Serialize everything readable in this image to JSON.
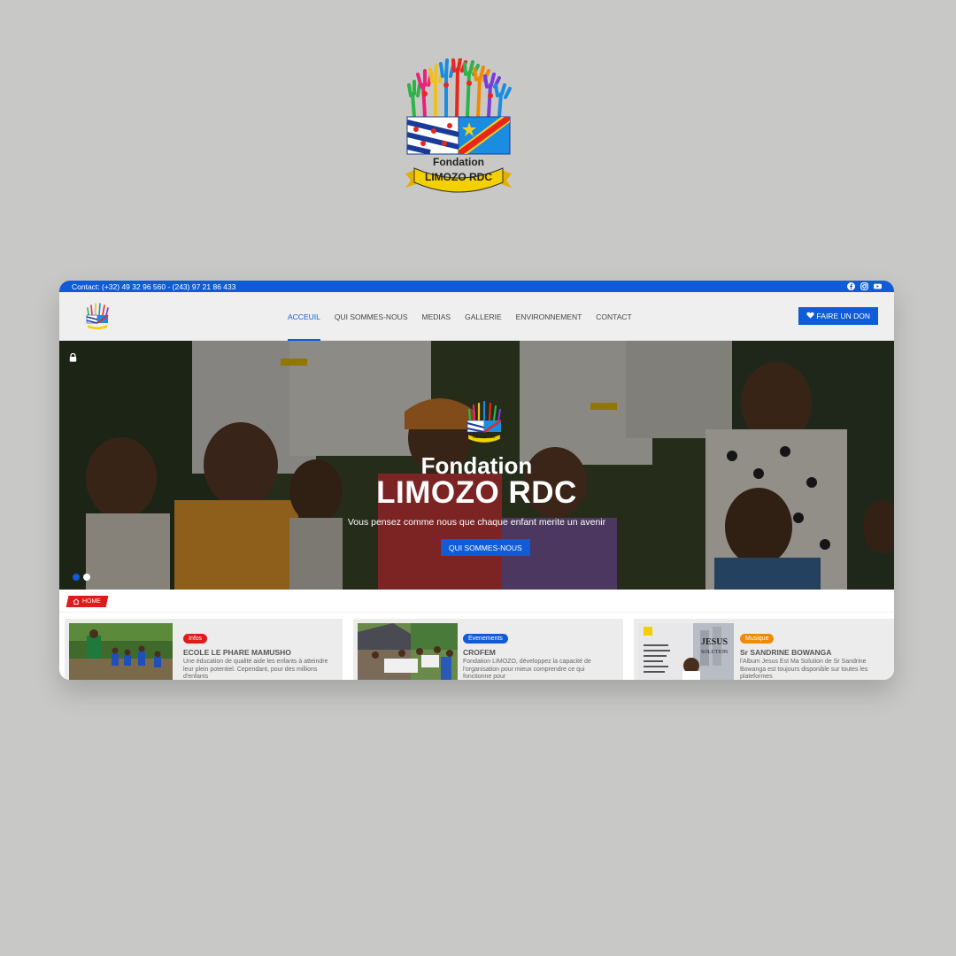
{
  "topbar": {
    "contact": "Contact: (+32) 49 32 96 560 - (243) 97 21 86 433",
    "socials": [
      "facebook-icon",
      "instagram-icon",
      "youtube-icon"
    ]
  },
  "brand": {
    "logo_line1": "Fondation",
    "logo_line2": "LIMOZO RDC",
    "logo_small": "LIMOZO RDC"
  },
  "nav": {
    "items": [
      {
        "label": "ACCEUIL",
        "active": true
      },
      {
        "label": "QUI SOMMES-NOUS",
        "active": false
      },
      {
        "label": "MEDIAS",
        "active": false
      },
      {
        "label": "GALLERIE",
        "active": false
      },
      {
        "label": "ENVIRONNEMENT",
        "active": false
      },
      {
        "label": "CONTACT",
        "active": false
      }
    ],
    "donate_label": "FAIRE UN DON"
  },
  "hero": {
    "title_line1": "Fondation",
    "title_line2": "LIMOZO RDC",
    "subtitle": "Vous pensez comme nous que chaque enfant merite un avenir",
    "button": "QUI SOMMES-NOUS",
    "slides": 2,
    "active_slide": 1
  },
  "breadcrumb": {
    "home": "HOME"
  },
  "cards": [
    {
      "tag": "Infos",
      "tag_color": "#e01a1a",
      "title": "ECOLE LE PHARE MAMUSHO",
      "text": "Une éducation de qualité aide les enfants à atteindre leur plein potentiel. Cependant, pour des millions d'enfants"
    },
    {
      "tag": "Evenements",
      "tag_color": "#0f5bd8",
      "title": "CROFEM",
      "text": "Fondation LIMOZO, développez la capacité de l'organisation pour mieux comprendre ce qui fonctionne pour"
    },
    {
      "tag": "Musique",
      "tag_color": "#f08a00",
      "title": "Sr SANDRINE BOWANGA",
      "text": "l'Album Jesus Est Ma Solution de Sr Sandrine Bowanga est toujours disponible sur toutes les plateformes",
      "thumb_text": "JESUS SOLUTION"
    }
  ],
  "colors": {
    "primary": "#0f5bd8",
    "red": "#e01a1a",
    "orange": "#f08a00",
    "background": "#c8c8c6"
  }
}
